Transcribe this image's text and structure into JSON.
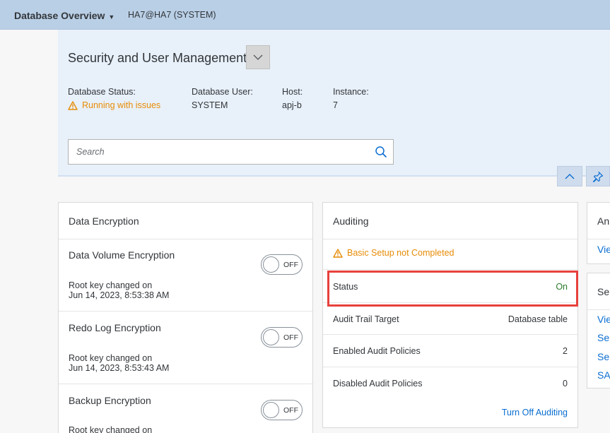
{
  "topbar": {
    "title": "Database Overview",
    "system": "HA7@HA7 (SYSTEM)"
  },
  "header": {
    "title": "Security and User Management",
    "attributes": [
      {
        "label": "Database Status:",
        "value": "Running with issues"
      },
      {
        "label": "Database User:",
        "value": "SYSTEM"
      },
      {
        "label": "Host:",
        "value": "apj-b"
      },
      {
        "label": "Instance:",
        "value": "7"
      }
    ],
    "search": {
      "placeholder": "Search"
    }
  },
  "data_encryption": {
    "title": "Data Encryption",
    "items": [
      {
        "name": "Data Volume Encryption",
        "toggle": "OFF",
        "note1": "Root key changed on",
        "note2": "Jun 14, 2023, 8:53:38 AM"
      },
      {
        "name": "Redo Log Encryption",
        "toggle": "OFF",
        "note1": "Root key changed on",
        "note2": "Jun 14, 2023, 8:53:43 AM"
      },
      {
        "name": "Backup Encryption",
        "toggle": "OFF",
        "note1": "Root key changed on",
        "note2": ""
      }
    ]
  },
  "auditing": {
    "title": "Auditing",
    "warning": "Basic Setup not Completed",
    "rows": [
      {
        "label": "Status",
        "value": "On"
      },
      {
        "label": "Audit Trail Target",
        "value": "Database table"
      },
      {
        "label": "Enabled Audit Policies",
        "value": "2"
      },
      {
        "label": "Disabled Audit Policies",
        "value": "0"
      }
    ],
    "action": "Turn Off Auditing"
  },
  "card3": {
    "title": "An",
    "link": "Vie"
  },
  "card4": {
    "title": "Se",
    "links": [
      "Vie",
      "Se",
      "Se",
      "SA"
    ]
  },
  "colors": {
    "accent": "#0a6ed1",
    "warning": "#e78c07",
    "success": "#2b7c2b",
    "highlight": "#e8413c",
    "shell": "#b9cfe6"
  },
  "icons": {
    "header_dropdown": "chevron-down-icon",
    "search": "search-icon",
    "collapse": "chevron-up-icon",
    "pin": "pin-icon",
    "warning": "warning-triangle-icon"
  }
}
